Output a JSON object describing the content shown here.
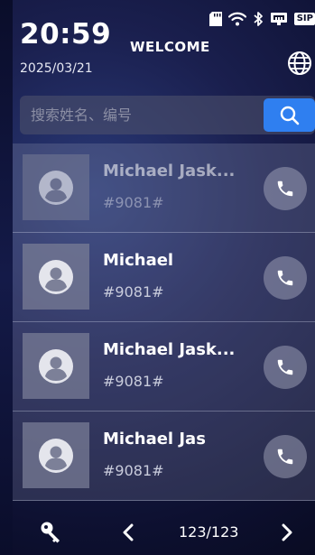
{
  "status_bar": {
    "time": "20:59",
    "date": "2025/03/21",
    "title": "WELCOME",
    "icons": [
      "sd-card-icon",
      "wifi-icon",
      "bluetooth-icon",
      "network-icon",
      "sip-badge"
    ],
    "sip_label": "SIP"
  },
  "search": {
    "placeholder": "搜索姓名、编号",
    "value": ""
  },
  "contacts": [
    {
      "name": "Michael Jask...",
      "number": "#9081#"
    },
    {
      "name": "Michael",
      "number": "#9081#"
    },
    {
      "name": "Michael Jask...",
      "number": "#9081#"
    },
    {
      "name": "Michael Jas",
      "number": "#9081#"
    }
  ],
  "pagination": {
    "label": "123/123"
  },
  "colors": {
    "accent": "#2f7ff0",
    "background": "#1a1f4e"
  }
}
